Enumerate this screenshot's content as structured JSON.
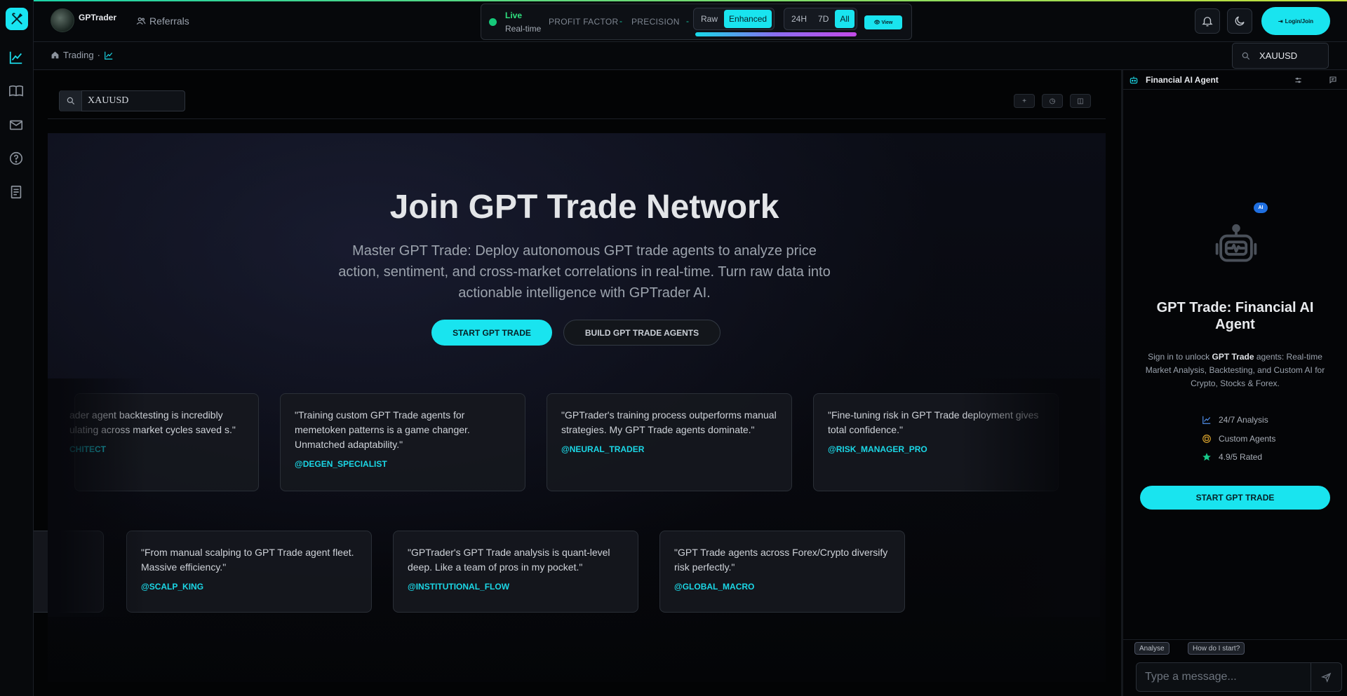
{
  "header": {
    "brand": "GPTrader",
    "referrals": "Referrals",
    "live": "Live",
    "realtime": "Real-time",
    "profit_factor_label": "PROFIT FACTOR",
    "profit_factor_value": "-",
    "precision_label": "PRECISION",
    "precision_value": "-",
    "mode_options": [
      "Raw",
      "Enhanced"
    ],
    "mode_selected": "Enhanced",
    "range_options": [
      "24H",
      "7D",
      "All"
    ],
    "range_selected": "All",
    "view_label": "View",
    "login_label": "Login/Join"
  },
  "breadcrumb": {
    "trading": "Trading",
    "separator": "·"
  },
  "top_search": {
    "value": "XAUUSD"
  },
  "main": {
    "search_value": "XAUUSD",
    "tools": [
      "+",
      "◷",
      "◫"
    ],
    "title": "Join GPT Trade Network",
    "subtitle": "Master GPT Trade: Deploy autonomous GPT trade agents to analyze price action, sentiment, and cross-market correlations in real-time. Turn raw data into actionable intelligence with GPTrader AI.",
    "cta_primary": "START GPT TRADE ",
    "cta_secondary": "BUILD GPT TRADE AGENTS ",
    "testimonials_row1": [
      {
        "quote": "ader agent backtesting is incredibly ulating across market cycles saved s.\"",
        "handle": "CHITECT"
      },
      {
        "quote": "\"Training custom GPT Trade agents for memetoken patterns is a game changer. Unmatched adaptability.\"",
        "handle": "@DEGEN_SPECIALIST"
      },
      {
        "quote": "\"GPTrader's training process outperforms manual strategies. My GPT Trade agents dominate.\"",
        "handle": "@NEURAL_TRADER"
      },
      {
        "quote": "\"Fine-tuning risk in GPT Trade deployment gives total confidence.\"",
        "handle": "@RISK_MANAGER_PRO"
      }
    ],
    "testimonials_row2": [
      {
        "quote": "\"From manual scalping to GPT Trade agent fleet. Massive efficiency.\"",
        "handle": "@SCALP_KING"
      },
      {
        "quote": "\"GPTrader's GPT Trade analysis is quant-level deep. Like a team of pros in my pocket.\"",
        "handle": "@INSTITUTIONAL_FLOW"
      },
      {
        "quote": "\"GPT Trade agents across Forex/Crypto diversify risk perfectly.\"",
        "handle": "@GLOBAL_MACRO"
      }
    ]
  },
  "panel": {
    "title": "Financial AI Agent",
    "badge": "AI",
    "heading": "GPT Trade: Financial AI Agent",
    "desc_pre": "Sign in to unlock ",
    "desc_bold": "GPT Trade",
    "desc_post": " agents: Real-time Market Analysis, Backtesting, and Custom AI for Crypto, Stocks & Forex.",
    "features": [
      "24/7 Analysis",
      "Custom Agents",
      "4.9/5 Rated"
    ],
    "cta": "START GPT TRADE ",
    "chips": [
      "Analyse ",
      "How do I start? "
    ],
    "message_placeholder": "Type a message..."
  },
  "colors": {
    "accent": "#19e4ef",
    "live": "#16c97a",
    "handle": "#1bd7e6",
    "badge": "#1f6fe0"
  },
  "icons": [
    "tools-logo-icon",
    "chart-line-icon",
    "book-icon",
    "mail-icon",
    "help-icon",
    "document-icon",
    "users-icon",
    "bell-icon",
    "moon-icon",
    "home-icon",
    "search-icon",
    "robot-icon",
    "sliders-icon",
    "chat-icon",
    "send-icon",
    "star-icon",
    "coin-icon"
  ]
}
